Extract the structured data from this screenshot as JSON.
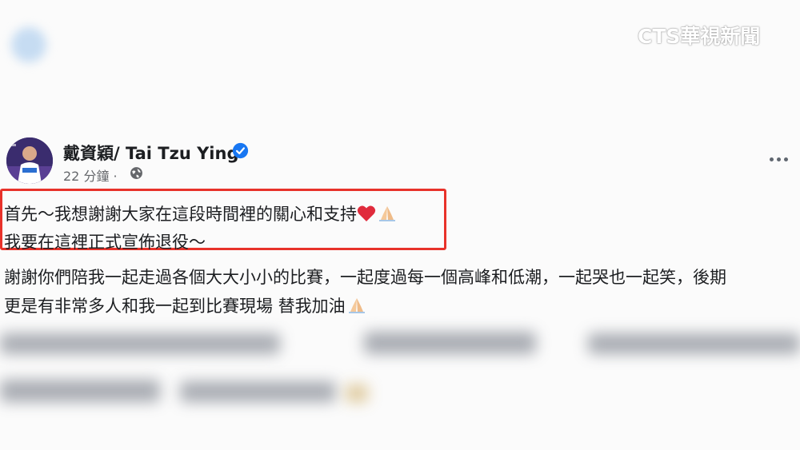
{
  "watermark": {
    "text": "CTS華視新聞"
  },
  "post": {
    "author": "戴資穎/ Tai Tzu Ying",
    "time": "22 分鐘 ·",
    "highlighted_lines": [
      "首先～我想謝謝大家在這段時間裡的關心和支持",
      "我要在這裡正式宣佈退役～"
    ],
    "body_lines": [
      "謝謝你們陪我一起走過各個大大小小的比賽，一起度過每一個高峰和低潮，一起哭也一起笑，後期",
      "更是有非常多人和我一起到比賽現場 替我加油"
    ],
    "icons": [
      "verified-icon",
      "globe-icon",
      "more-options-icon",
      "heart-emoji",
      "folded-hands-emoji"
    ]
  },
  "colors": {
    "highlight_border": "#e8322a",
    "verified_blue": "#1877f2",
    "secondary_text": "#65676b"
  }
}
